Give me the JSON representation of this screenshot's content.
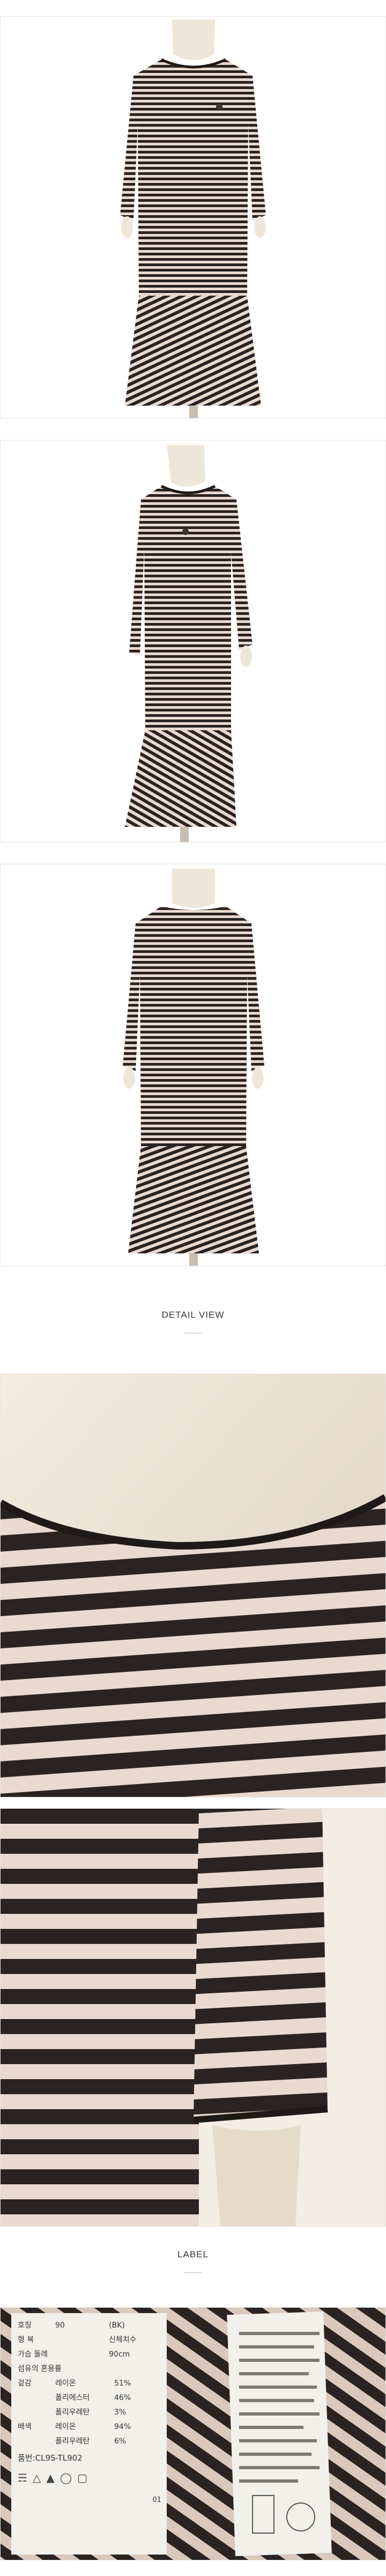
{
  "sections": {
    "detail_title": "DETAIL VIEW",
    "label_title": "LABEL"
  },
  "care_label": {
    "lines": [
      {
        "key": "호칭",
        "value": "90",
        "extra": "(BK)"
      },
      {
        "key": "형  복",
        "value": "",
        "extra": "신체치수"
      },
      {
        "key": "가슴 둘레",
        "value": "",
        "extra": "90cm"
      },
      {
        "key": "섬유의 혼용률",
        "value": "",
        "extra": ""
      },
      {
        "key": "겉감",
        "value": "레이온",
        "extra": "51%"
      },
      {
        "key": "",
        "value": "폴리에스터",
        "extra": "46%"
      },
      {
        "key": "",
        "value": "폴리우레탄",
        "extra": "3%"
      },
      {
        "key": "배색",
        "value": "레이온",
        "extra": "94%"
      },
      {
        "key": "",
        "value": "폴리우레탄",
        "extra": "6%"
      }
    ],
    "style_code": "품번:CL9S-TL902",
    "number": "01"
  },
  "colors": {
    "stripe_dark": "#2b2321",
    "stripe_light": "#e9d9cf",
    "mannequin": "#efe6da",
    "label_fabric": "#f2f0ea"
  }
}
